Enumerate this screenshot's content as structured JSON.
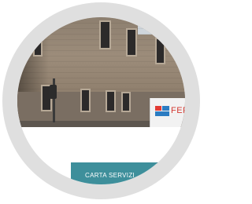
{
  "sign": {
    "brand_text": "FERR"
  },
  "service_button": {
    "label": "CARTA SERVIZI"
  },
  "colors": {
    "accent_teal": "#3e8f9b",
    "accent_teal_dark": "#2a6f7b",
    "ring_gray": "#dfdfdf",
    "logo_red": "#e23b33",
    "logo_blue": "#2b7cc2"
  },
  "icons": {
    "logo": "brand-logo-icon",
    "traffic_light": "traffic-light-icon"
  }
}
